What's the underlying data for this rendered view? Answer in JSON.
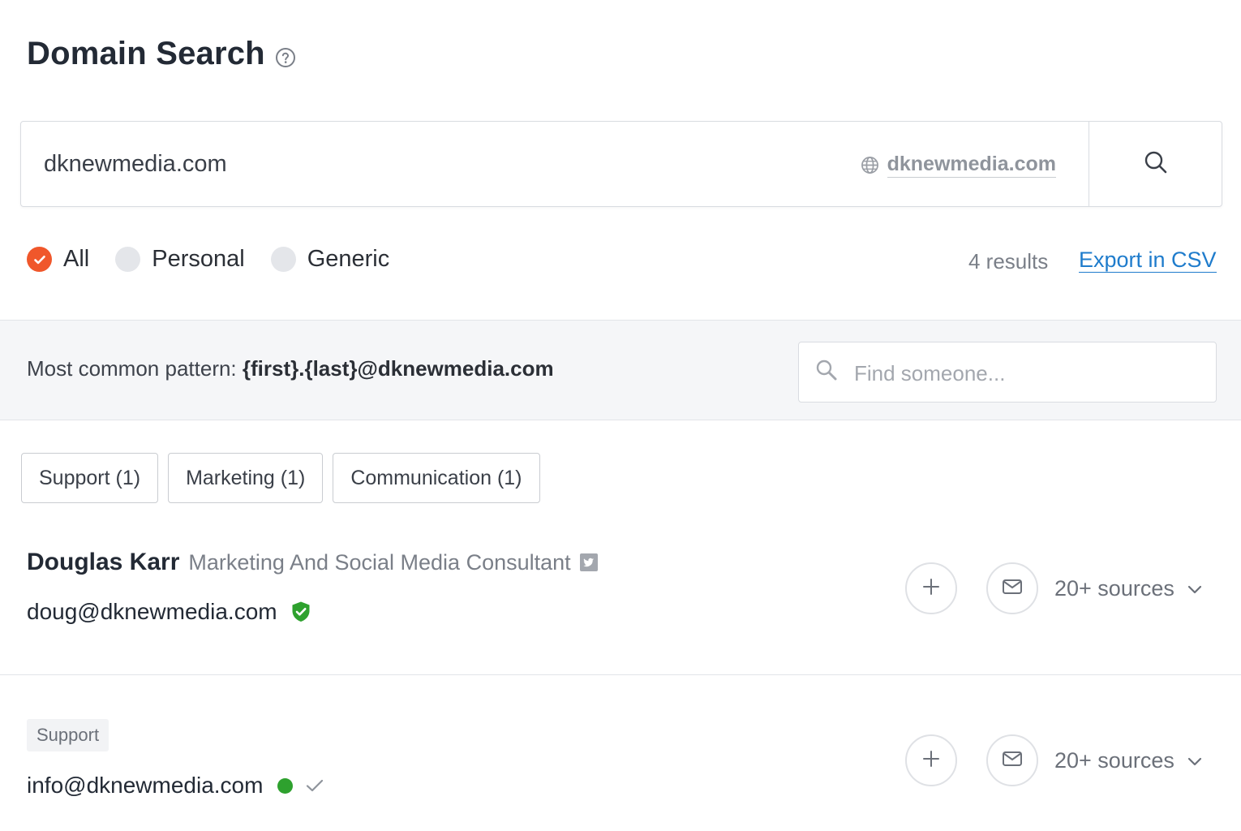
{
  "page": {
    "title": "Domain Search"
  },
  "search": {
    "value": "dknewmedia.com",
    "domain_label": "dknewmedia.com"
  },
  "filters": {
    "options": [
      "All",
      "Personal",
      "Generic"
    ],
    "selected": "All"
  },
  "results": {
    "count_label": "4 results",
    "export_label": "Export in CSV"
  },
  "pattern": {
    "prefix": "Most common pattern:",
    "value": "{first}.{last}@dknewmedia.com",
    "find_placeholder": "Find someone..."
  },
  "departments": [
    "Support (1)",
    "Marketing (1)",
    "Communication (1)"
  ],
  "people": [
    {
      "name": "Douglas Karr",
      "position": "Marketing And Social Media Consultant",
      "email": "doug@dknewmedia.com",
      "verification": "verified-shield",
      "sources_label": "20+ sources"
    },
    {
      "tag": "Support",
      "email": "info@dknewmedia.com",
      "verification": "green-dot-check",
      "sources_label": "20+ sources"
    }
  ],
  "colors": {
    "accent": "#f0572b",
    "link": "#1f7ccc",
    "verified": "#2ea12e"
  }
}
